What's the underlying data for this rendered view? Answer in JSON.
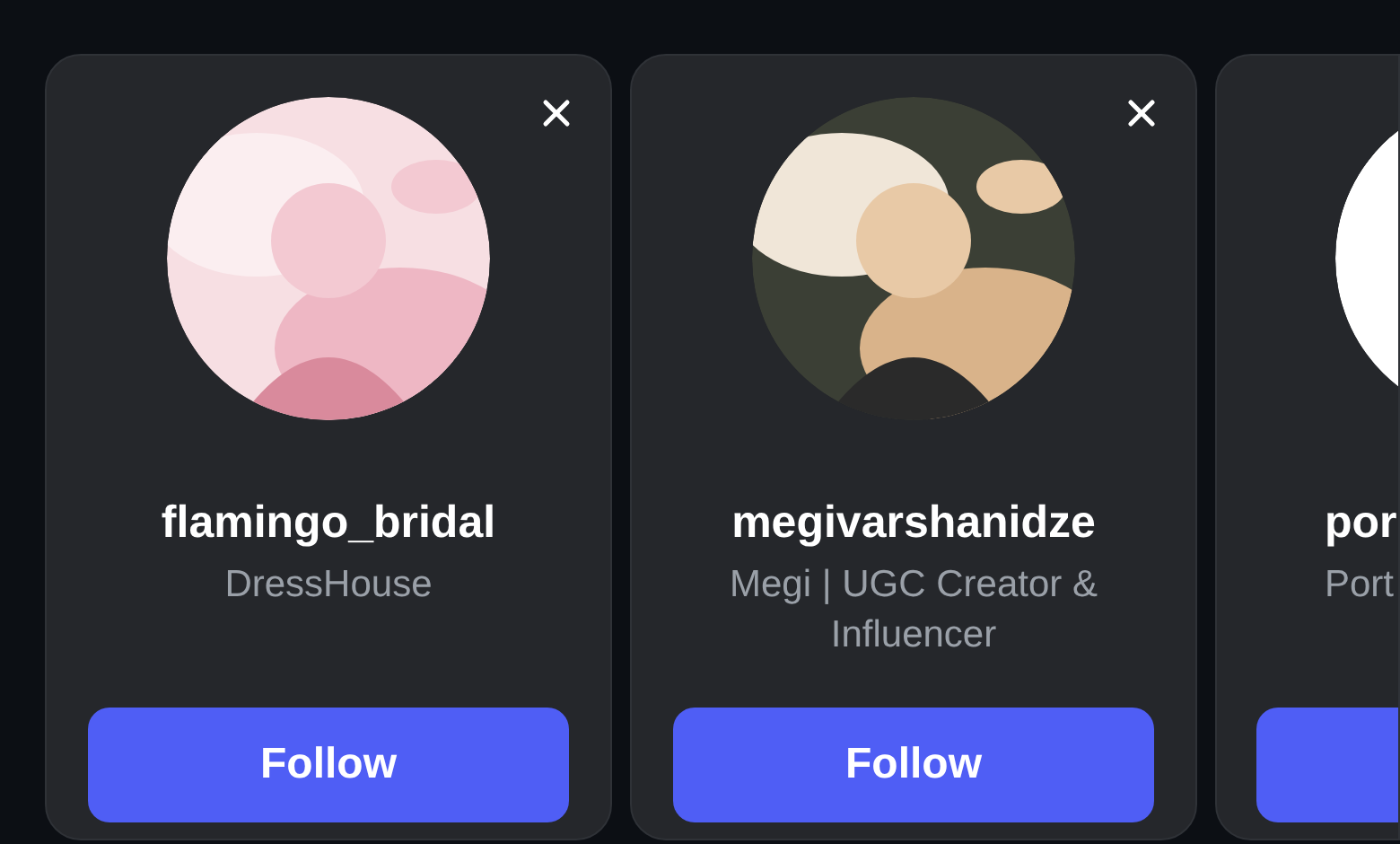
{
  "suggestions": [
    {
      "username": "flamingo_bridal",
      "subtitle": "DressHouse",
      "button": "Follow",
      "dismissible": true,
      "cut_off": false
    },
    {
      "username": "megivarshanidze",
      "subtitle": "Megi | UGC Creator & Influencer",
      "button": "Follow",
      "dismissible": true,
      "cut_off": false
    },
    {
      "username": "por",
      "subtitle": "Port",
      "dismissible": false,
      "cut_off": true
    }
  ]
}
